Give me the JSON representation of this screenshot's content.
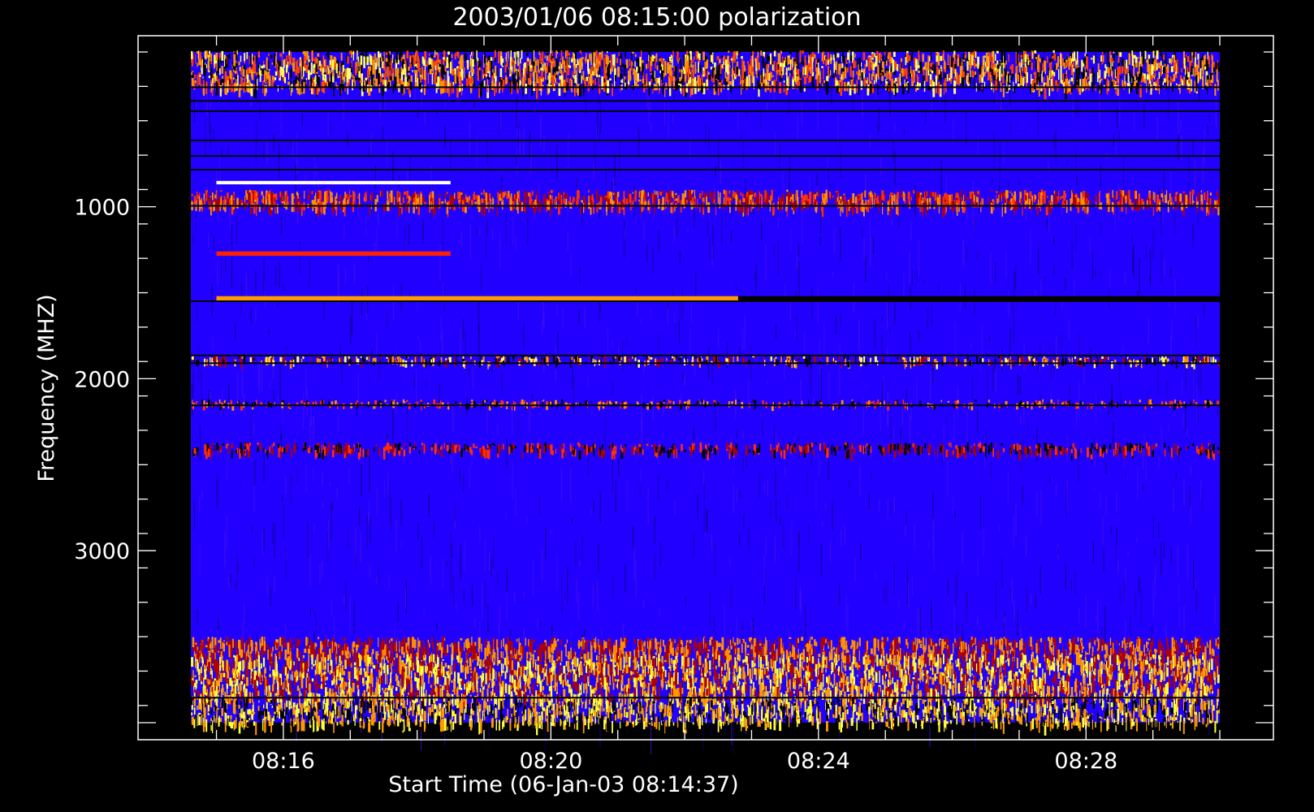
{
  "chart_data": {
    "type": "heatmap",
    "title": "2003/01/06 08:15:00 polarization",
    "xlabel": "Start Time (06-Jan-03 08:14:37)",
    "ylabel": "Frequency (MHZ)",
    "x_tick_labels": [
      "08:16",
      "08:20",
      "08:24",
      "08:28"
    ],
    "y_tick_labels": [
      "1000",
      "2000",
      "3000"
    ],
    "x_ticks_min": [
      16,
      20,
      24,
      28
    ],
    "y_ticks": [
      1000,
      2000,
      3000
    ],
    "y_inverted": true,
    "colormap": [
      "#000000",
      "#1a00c8",
      "#2a00ff",
      "#b00000",
      "#ff3000",
      "#ff9a00",
      "#ffff40",
      "#ffffff"
    ],
    "background_color": "#2200ff",
    "bands": [
      {
        "freq_range": [
          90,
          300
        ],
        "pattern": "speckle",
        "colors": [
          "#ff4000",
          "#ff9000",
          "#000000",
          "#ffff60"
        ]
      },
      {
        "freq_range": [
          850,
          870
        ],
        "pattern": "solid-partial",
        "time_range": [
          15,
          18.5
        ],
        "colors": [
          "#ffffff"
        ]
      },
      {
        "freq_range": [
          900,
          990
        ],
        "pattern": "speckle",
        "colors": [
          "#ff3000",
          "#b00000",
          "#ff9000"
        ]
      },
      {
        "freq_range": [
          1260,
          1285
        ],
        "pattern": "solid-partial",
        "time_range": [
          15,
          18.5
        ],
        "colors": [
          "#ff2000"
        ]
      },
      {
        "freq_range": [
          1520,
          1545
        ],
        "pattern": "solid-partial",
        "time_range": [
          15,
          22.8
        ],
        "colors": [
          "#ff9a00"
        ]
      },
      {
        "freq_range": [
          1520,
          1545
        ],
        "pattern": "solid-partial",
        "time_range": [
          22.8,
          30
        ],
        "colors": [
          "#000000"
        ]
      },
      {
        "freq_range": [
          1860,
          1900
        ],
        "pattern": "speckle",
        "colors": [
          "#ffff60",
          "#ff9000",
          "#000000",
          "#b00000"
        ]
      },
      {
        "freq_range": [
          2120,
          2150
        ],
        "pattern": "speckle",
        "colors": [
          "#ff3000",
          "#ff9000",
          "#000000"
        ]
      },
      {
        "freq_range": [
          2370,
          2420
        ],
        "pattern": "speckle",
        "colors": [
          "#ff3000",
          "#b00000",
          "#000000"
        ]
      },
      {
        "freq_range": [
          3500,
          3600
        ],
        "pattern": "speckle",
        "colors": [
          "#b00000",
          "#ff9000"
        ]
      },
      {
        "freq_range": [
          3600,
          3850
        ],
        "pattern": "speckle",
        "colors": [
          "#ffff40",
          "#ff9a00",
          "#b00000"
        ]
      },
      {
        "freq_range": [
          3850,
          4000
        ],
        "pattern": "speckle",
        "colors": [
          "#ffff40",
          "#ff9a00",
          "#000000"
        ]
      }
    ]
  }
}
